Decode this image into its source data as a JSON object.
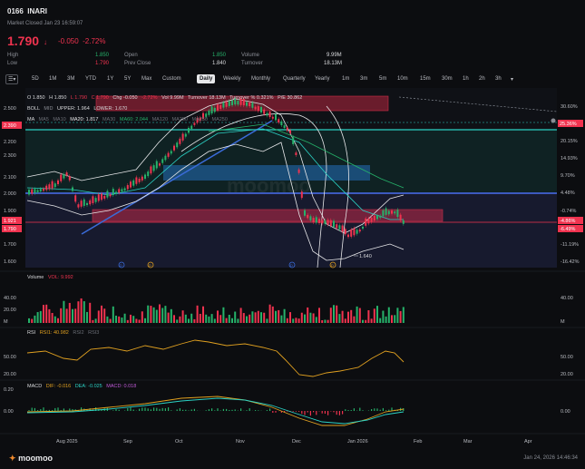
{
  "header": {
    "code": "0166",
    "name": "INARI",
    "market_status": "Market Closed Jan 23 16:59:07",
    "price": "1.790",
    "arrow": "↓",
    "change": "-0.050",
    "change_pct": "-2.72%"
  },
  "stats": [
    {
      "label": "High",
      "value": "1.850",
      "color": "#26b26a"
    },
    {
      "label": "Low",
      "value": "1.790",
      "color": "#f0334f"
    },
    {
      "label": "Open",
      "value": "1.850",
      "color": "#26b26a"
    },
    {
      "label": "Prev Close",
      "value": "1.840",
      "color": "#d8d9dc"
    },
    {
      "label": "Volume",
      "value": "9.99M",
      "color": "#d8d9dc"
    },
    {
      "label": "Turnover",
      "value": "18.13M",
      "color": "#d8d9dc"
    }
  ],
  "toolbar": {
    "menu_icon": "menu-icon",
    "ranges": [
      "5D",
      "1M",
      "3M",
      "YTD",
      "1Y",
      "5Y",
      "Max",
      "Custom"
    ],
    "periods": [
      "Daily",
      "Weekly",
      "Monthly",
      "Quarterly",
      "Yearly",
      "1m",
      "3m",
      "5m",
      "10m",
      "15m",
      "30m",
      "1h",
      "2h",
      "3h"
    ],
    "active_period": "Daily",
    "dropdown_icon": "chevron-down-icon"
  },
  "price_panel": {
    "ohlc": {
      "o": "O 1.850",
      "h": "H 1.850",
      "l": "L 1.790",
      "c": "C 1.790",
      "chg": "Chg -0.050",
      "chgp": "-2.72%",
      "vol": "Vol 9.99M",
      "turnover": "Turnover 18.13M",
      "turnover_pct": "Turnover % 0.321%",
      "pe": "P/E 30.862"
    },
    "boll": {
      "label": "BOLL",
      "mid": "MID",
      "upper": "UPPER: 1.964",
      "lower": "LOWER: 1.670"
    },
    "ma": {
      "label": "MA",
      "ma5": "MA5",
      "ma10": "MA10",
      "ma20": "MA20: 1.817",
      "ma30": "MA30",
      "ma60": "MA60: 2.044",
      "ma120": "MA120",
      "ma250": "MA250",
      "ma5b": "MA250",
      "ma10b": "MA250"
    },
    "y_ticks": [
      "2.500",
      "2.300",
      "2.100",
      "2.000",
      "1.900",
      "1.700",
      "1.600"
    ],
    "y_ticks_aux": [
      "2.400",
      "2.200"
    ],
    "y_left_tags": [
      {
        "text": "2.390",
        "color": "#f0334f"
      },
      {
        "text": "1.921",
        "color": "#f0334f"
      },
      {
        "text": "1.790",
        "color": "#f0334f"
      }
    ],
    "pct_ticks": [
      "30.60%",
      "20.15%",
      "14.93%",
      "9.70%",
      "4.48%",
      "-0.74%",
      "-11.19%",
      "-16.42%"
    ],
    "pct_tags": [
      {
        "text": "25.36%",
        "color": "#f0334f"
      },
      {
        "text": "-4.86%",
        "color": "#f0334f"
      },
      {
        "text": "-6.49%",
        "color": "#f0334f"
      }
    ],
    "low_label": "1.640",
    "event_markers": [
      "D",
      "D",
      "D",
      "D"
    ]
  },
  "volume_panel": {
    "label": "Volume",
    "vol": "VOL: 9.992",
    "y_ticks": [
      "40.00",
      "20.00",
      "M"
    ],
    "y_right": [
      "40.00",
      "M"
    ]
  },
  "rsi_panel": {
    "label": "RSI",
    "rsi1": "RSI1: 40.982",
    "rsi2": "RSI2",
    "rsi3": "RSI3",
    "y_ticks": [
      "50.00",
      "20.00"
    ],
    "y_right": [
      "50.00",
      "20.00"
    ]
  },
  "macd_panel": {
    "label": "MACD",
    "dif": "DIF: -0.016",
    "dea": "DEA: -0.025",
    "macd": "MACD: 0.018",
    "y_ticks": [
      "0.20",
      "0.00"
    ],
    "y_right": [
      "0.00"
    ]
  },
  "x_axis": [
    "Aug 2025",
    "Sep",
    "Oct",
    "Nov",
    "Dec",
    "Jan 2026",
    "Feb",
    "Mar",
    "Apr"
  ],
  "footer": {
    "logo": "moomoo",
    "timestamp": "Jan 24, 2026 14:46:34"
  },
  "colors": {
    "up": "#26b26a",
    "down": "#f0334f",
    "accent": "#3a6bd8",
    "cyan": "#2bd1c4"
  }
}
